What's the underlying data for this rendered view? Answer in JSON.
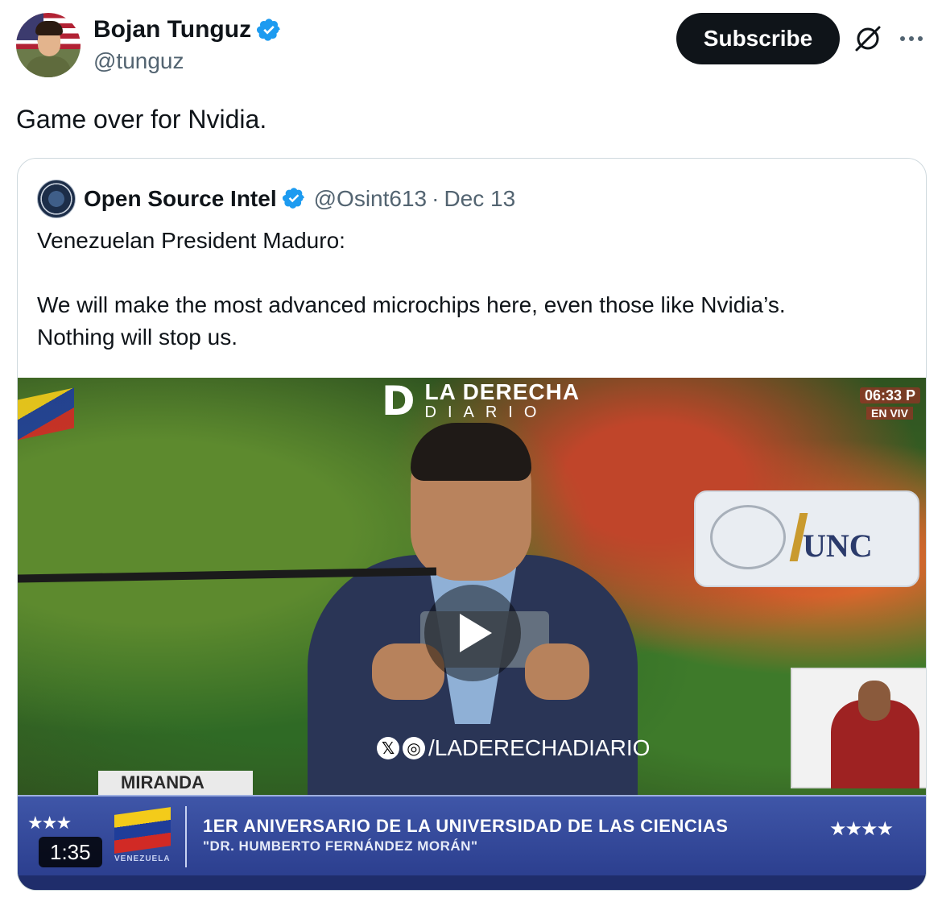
{
  "author": {
    "display_name": "Bojan Tunguz",
    "handle": "@tunguz",
    "verified_icon": "verified-badge-icon"
  },
  "actions": {
    "subscribe_label": "Subscribe",
    "grok_icon": "grok-icon",
    "more_icon": "more-icon"
  },
  "post": {
    "text": "Game over for Nvidia."
  },
  "quoted": {
    "display_name": "Open Source Intel",
    "handle": "@Osint613",
    "separator": "·",
    "date": "Dec 13",
    "paragraphs": [
      "Venezuelan President Maduro:",
      "",
      "We will make the most advanced microchips here, even those like Nvidia’s.",
      "Nothing will stop us."
    ]
  },
  "video": {
    "duration": "1:35",
    "play_icon": "play-icon",
    "overlay": {
      "brand_main": "LA DERECHA",
      "brand_sub": "DIARIO",
      "brand_letter": "D",
      "live_time": "06:33 P",
      "live_label": "EN VIV",
      "watermark": "/LADERECHADIARIO",
      "sign_text": "UNC",
      "location_tab": "MIRANDA",
      "lower_third_line1": "1ER ANIVERSARIO DE LA UNIVERSIDAD DE LAS CIENCIAS",
      "lower_third_line2": "\"DR. HUMBERTO FERNÁNDEZ MORÁN\"",
      "flag_caption": "VENEZUELA",
      "stars_left": "★★★",
      "stars_right": "★★★★"
    }
  },
  "colors": {
    "accent": "#1d9bf0",
    "text": "#0f1419",
    "muted": "#536471",
    "border": "#cfd9de",
    "subscribe_bg": "#0f1419"
  }
}
